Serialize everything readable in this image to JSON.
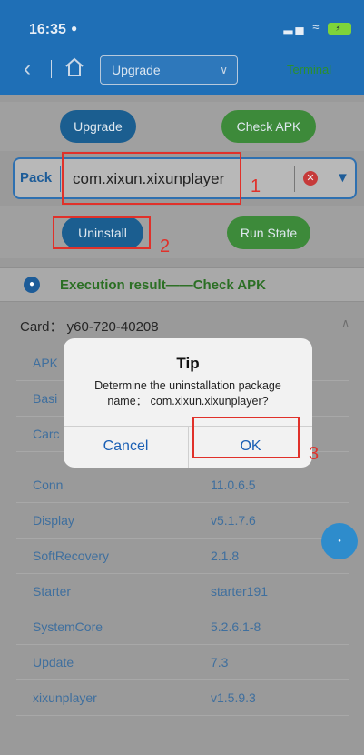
{
  "status": {
    "time": "16:35",
    "user_glyph": "•"
  },
  "nav": {
    "select_value": "Upgrade",
    "terminal_label": "Terminal"
  },
  "buttons": {
    "upgrade": "Upgrade",
    "check_apk": "Check APK",
    "uninstall": "Uninstall",
    "run_state": "Run State"
  },
  "package": {
    "label": "Pack",
    "value": "com.xixun.xixunplayer"
  },
  "annotations": {
    "n1": "1",
    "n2": "2",
    "n3": "3"
  },
  "execution": {
    "title": "Execution result——Check APK"
  },
  "card": {
    "label": "Card： y60-720-40208"
  },
  "apk_list": [
    {
      "name": "APK",
      "value": ""
    },
    {
      "name": "Basi",
      "value": ""
    },
    {
      "name": "Carc",
      "value": ""
    },
    {
      "name": "Conn",
      "value": "11.0.6.5"
    },
    {
      "name": "Display",
      "value": "v5.1.7.6"
    },
    {
      "name": "SoftRecovery",
      "value": "2.1.8"
    },
    {
      "name": "Starter",
      "value": "starter191"
    },
    {
      "name": "SystemCore",
      "value": "5.2.6.1-8"
    },
    {
      "name": "Update",
      "value": "7.3"
    },
    {
      "name": "xixunplayer",
      "value": "v1.5.9.3"
    }
  ],
  "dialog": {
    "title": "Tip",
    "message_line1": "Determine the uninstallation package",
    "message_line2": "name： com.xixun.xixunplayer?",
    "cancel": "Cancel",
    "ok": "OK"
  },
  "colors": {
    "header": "#1f6fb6",
    "annotation": "#e0312a",
    "dialog_action": "#1a5fb4"
  }
}
